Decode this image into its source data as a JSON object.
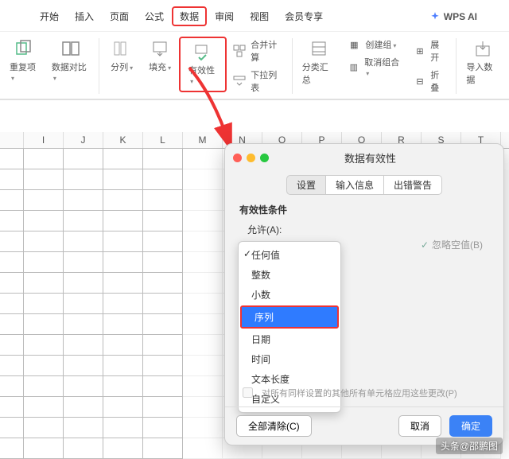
{
  "menu": {
    "items": [
      "开始",
      "插入",
      "页面",
      "公式",
      "数据",
      "审阅",
      "视图",
      "会员专享"
    ],
    "active_index": 4,
    "wpsai": "WPS AI"
  },
  "ribbon": {
    "dup": "重复项",
    "compare": "数据对比",
    "split": "分列",
    "fill": "填充",
    "validity": "有效性",
    "consolidate": "合并计算",
    "dropdown": "下拉列表",
    "subtotal": "分类汇总",
    "group": "创建组",
    "ungroup": "取消组合",
    "expand": "展开",
    "collapse": "折叠",
    "import": "导入数据"
  },
  "sheet": {
    "cols": [
      "I",
      "J",
      "K",
      "L",
      "M",
      "N",
      "O",
      "P",
      "Q",
      "R",
      "S",
      "T"
    ]
  },
  "dialog": {
    "title": "数据有效性",
    "tabs": [
      "设置",
      "输入信息",
      "出错警告"
    ],
    "active_tab": 0,
    "section": "有效性条件",
    "allow_label": "允许(A):",
    "ignore_blank": "忽略空值(B)",
    "options": [
      "任何值",
      "整数",
      "小数",
      "序列",
      "日期",
      "时间",
      "文本长度",
      "自定义"
    ],
    "checked_index": 0,
    "selected_index": 3,
    "apply_all": "对所有同样设置的其他所有单元格应用这些更改(P)",
    "clear": "全部清除(C)",
    "cancel": "取消",
    "ok": "确定"
  },
  "watermark": "头条@邵鹏图"
}
